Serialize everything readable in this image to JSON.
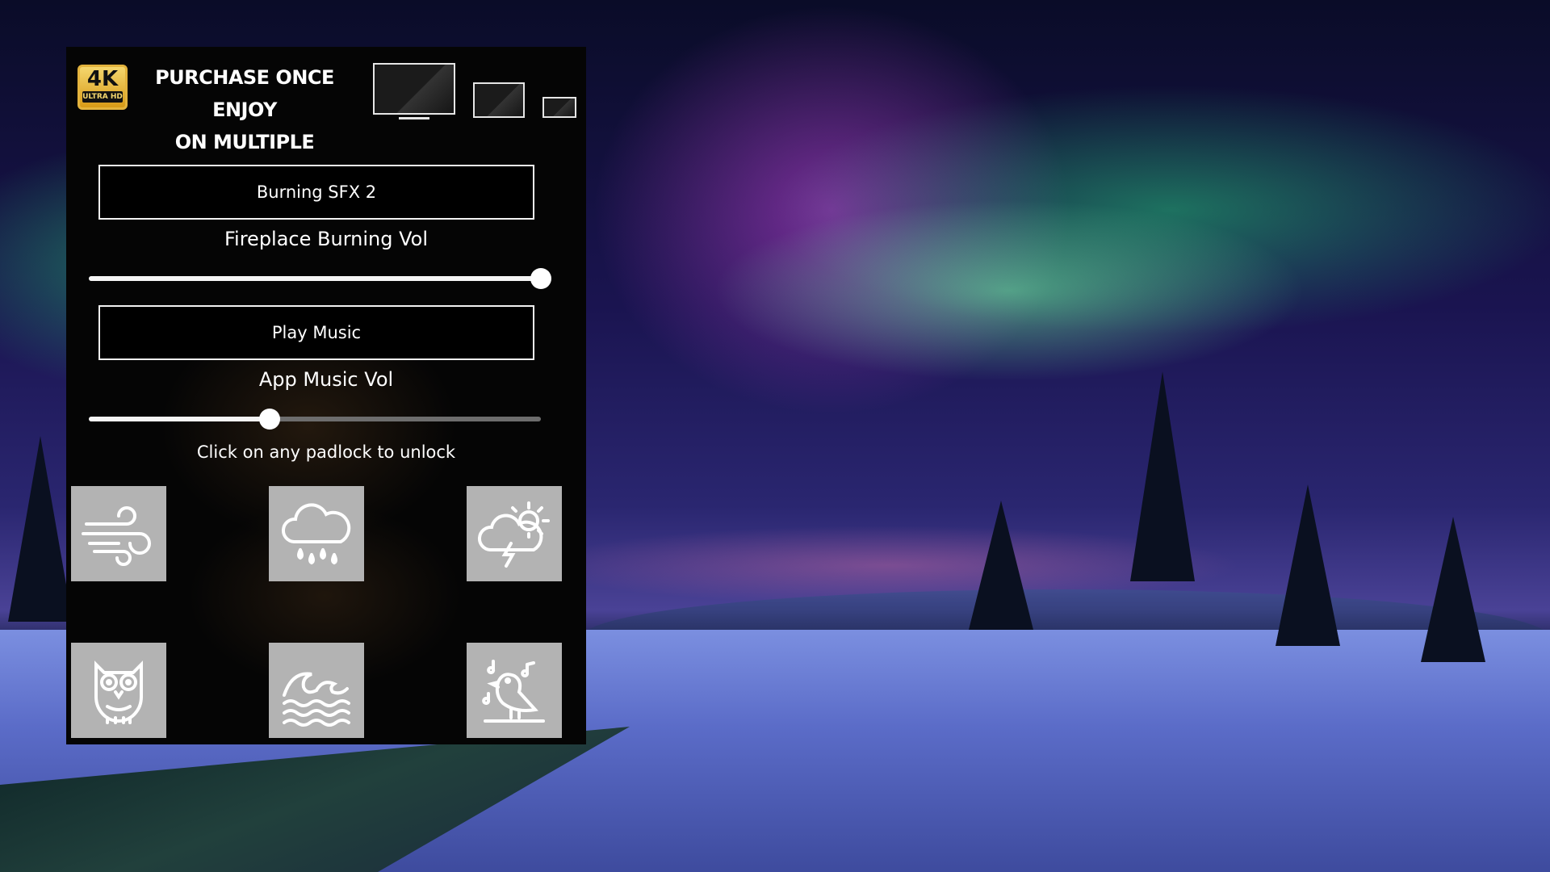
{
  "promo": {
    "badge_main": "4K",
    "badge_sub": "ULTRA HD",
    "line1": "PURCHASE ONCE ENJOY",
    "line2": "ON MULTIPLE DEVICES"
  },
  "fireplace": {
    "button_label": "Burning SFX 2",
    "volume_label": "Fireplace Burning Vol",
    "volume_percent": 100
  },
  "music": {
    "button_label": "Play Music",
    "volume_label": "App Music Vol",
    "volume_percent": 40
  },
  "unlock_hint": "Click on any padlock to unlock",
  "sound_tiles": [
    {
      "icon": "wind-icon"
    },
    {
      "icon": "rain-cloud-icon"
    },
    {
      "icon": "thunderstorm-sun-icon"
    },
    {
      "icon": "owl-icon"
    },
    {
      "icon": "ocean-waves-icon"
    },
    {
      "icon": "singing-bird-icon"
    }
  ]
}
